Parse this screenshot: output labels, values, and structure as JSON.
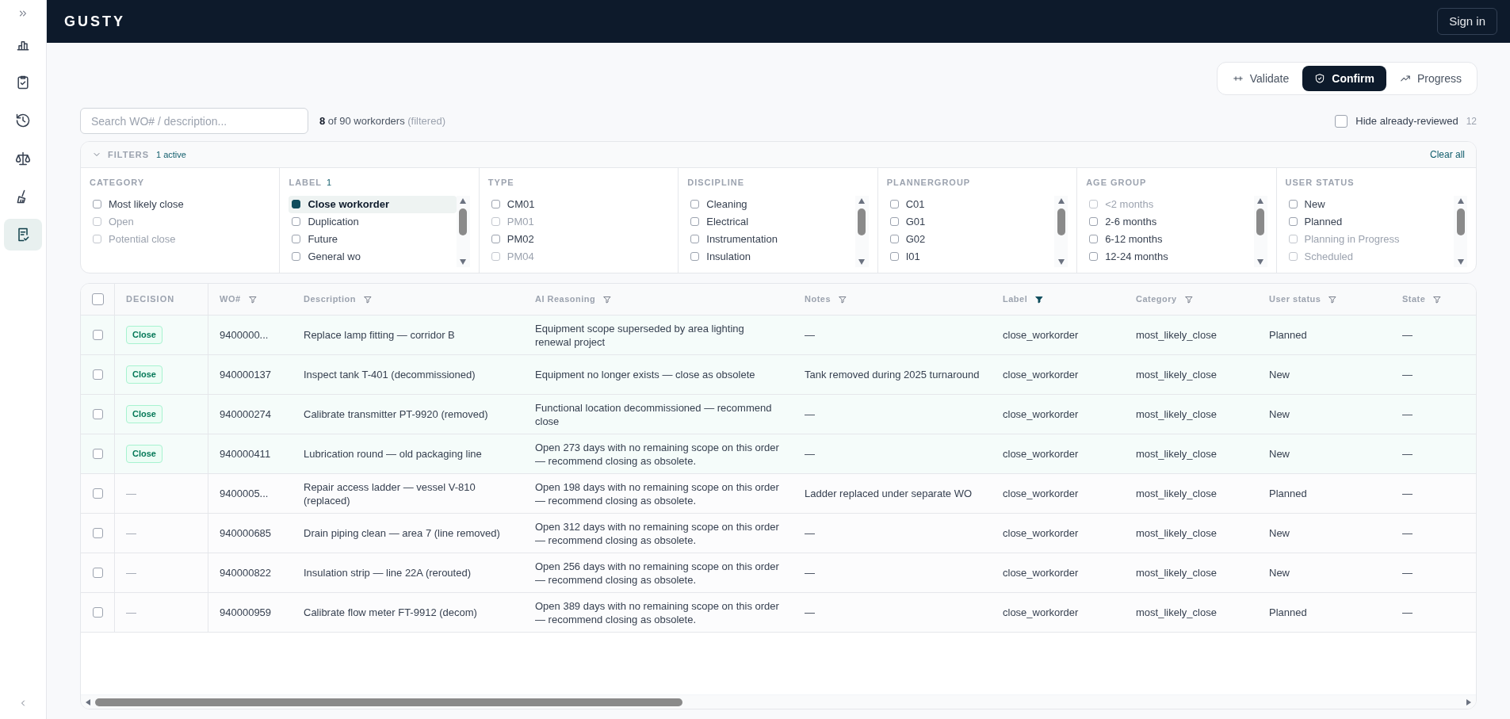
{
  "sidebar": {
    "items": [
      {
        "selected": false
      },
      {
        "selected": false
      },
      {
        "selected": false
      },
      {
        "selected": false
      },
      {
        "selected": false
      },
      {
        "selected": true
      }
    ]
  },
  "header": {
    "logo": "GUSTY",
    "sign_in": "Sign in"
  },
  "tabs": [
    {
      "label": "Validate",
      "selected": false
    },
    {
      "label": "Confirm",
      "selected": true
    },
    {
      "label": "Progress",
      "selected": false
    }
  ],
  "search": {
    "placeholder": "Search WO# / description..."
  },
  "count": {
    "shown": "8",
    "rest": "of 90 workorders",
    "note": "(filtered)"
  },
  "hide_reviewed": {
    "label": "Hide already-reviewed",
    "checked": false,
    "count": "12"
  },
  "filters": {
    "title": "FILTERS",
    "active": "1 active",
    "clear": "Clear all",
    "expanded": true,
    "groups": [
      {
        "title": "CATEGORY",
        "scrollable": false,
        "items": [
          {
            "label": "Most likely close",
            "checked": false,
            "disabled": false
          },
          {
            "label": "Open",
            "checked": false,
            "disabled": true
          },
          {
            "label": "Potential close",
            "checked": false,
            "disabled": true
          }
        ]
      },
      {
        "title": "LABEL",
        "badge": "1",
        "scrollable": true,
        "items": [
          {
            "label": "Close workorder",
            "checked": true,
            "disabled": false
          },
          {
            "label": "Duplication",
            "checked": false,
            "disabled": false
          },
          {
            "label": "Future",
            "checked": false,
            "disabled": false
          },
          {
            "label": "General wo",
            "checked": false,
            "disabled": false
          }
        ]
      },
      {
        "title": "TYPE",
        "scrollable": false,
        "items": [
          {
            "label": "CM01",
            "checked": false,
            "disabled": false
          },
          {
            "label": "PM01",
            "checked": false,
            "disabled": true
          },
          {
            "label": "PM02",
            "checked": false,
            "disabled": false
          },
          {
            "label": "PM04",
            "checked": false,
            "disabled": true
          }
        ]
      },
      {
        "title": "DISCIPLINE",
        "scrollable": true,
        "items": [
          {
            "label": "Cleaning",
            "checked": false,
            "disabled": false
          },
          {
            "label": "Electrical",
            "checked": false,
            "disabled": false
          },
          {
            "label": "Instrumentation",
            "checked": false,
            "disabled": false
          },
          {
            "label": "Insulation",
            "checked": false,
            "disabled": false
          }
        ]
      },
      {
        "title": "PLANNERGROUP",
        "scrollable": true,
        "items": [
          {
            "label": "C01",
            "checked": false,
            "disabled": false
          },
          {
            "label": "G01",
            "checked": false,
            "disabled": false
          },
          {
            "label": "G02",
            "checked": false,
            "disabled": false
          },
          {
            "label": "I01",
            "checked": false,
            "disabled": false
          }
        ]
      },
      {
        "title": "AGE GROUP",
        "scrollable": true,
        "items": [
          {
            "label": "<2 months",
            "checked": false,
            "disabled": true
          },
          {
            "label": "2-6 months",
            "checked": false,
            "disabled": false
          },
          {
            "label": "6-12 months",
            "checked": false,
            "disabled": false
          },
          {
            "label": "12-24 months",
            "checked": false,
            "disabled": false
          }
        ]
      },
      {
        "title": "USER STATUS",
        "scrollable": true,
        "items": [
          {
            "label": "New",
            "checked": false,
            "disabled": false
          },
          {
            "label": "Planned",
            "checked": false,
            "disabled": false
          },
          {
            "label": "Planning in Progress",
            "checked": false,
            "disabled": true
          },
          {
            "label": "Scheduled",
            "checked": false,
            "disabled": true
          }
        ]
      }
    ]
  },
  "table": {
    "all_checked": false,
    "columns": [
      {
        "label": "DECISION"
      },
      {
        "label": "WO#",
        "filter_active": false
      },
      {
        "label": "Description",
        "filter_active": false
      },
      {
        "label": "AI Reasoning",
        "filter_active": false
      },
      {
        "label": "Notes",
        "filter_active": false
      },
      {
        "label": "Label",
        "filter_active": true
      },
      {
        "label": "Category",
        "filter_active": false
      },
      {
        "label": "User status",
        "filter_active": false
      },
      {
        "label": "State",
        "filter_active": false
      }
    ],
    "rows": [
      {
        "checked": false,
        "reviewed": true,
        "cells": [
          "Close",
          "9400000...",
          "Replace lamp fitting — corridor B",
          "Equipment scope superseded by area lighting renewal project",
          "—",
          "close_workorder",
          "most_likely_close",
          "Planned",
          "—"
        ]
      },
      {
        "checked": false,
        "reviewed": true,
        "cells": [
          "Close",
          "940000137",
          "Inspect tank T-401 (decommissioned)",
          "Equipment no longer exists — close as obsolete",
          "Tank removed during 2025 turnaround",
          "close_workorder",
          "most_likely_close",
          "New",
          "—"
        ]
      },
      {
        "checked": false,
        "reviewed": true,
        "cells": [
          "Close",
          "940000274",
          "Calibrate transmitter PT-9920 (removed)",
          "Functional location decommissioned — recommend close",
          "—",
          "close_workorder",
          "most_likely_close",
          "New",
          "—"
        ]
      },
      {
        "checked": false,
        "reviewed": true,
        "cells": [
          "Close",
          "940000411",
          "Lubrication round — old packaging line",
          "Open 273 days with no remaining scope on this order — recommend closing as obsolete.",
          "—",
          "close_workorder",
          "most_likely_close",
          "New",
          "—"
        ]
      },
      {
        "checked": false,
        "reviewed": false,
        "cells": [
          "—",
          "9400005...",
          "Repair access ladder — vessel V-810 (replaced)",
          "Open 198 days with no remaining scope on this order — recommend closing as obsolete.",
          "Ladder replaced under separate WO",
          "close_workorder",
          "most_likely_close",
          "Planned",
          "—"
        ]
      },
      {
        "checked": false,
        "reviewed": false,
        "cells": [
          "—",
          "940000685",
          "Drain piping clean — area 7 (line removed)",
          "Open 312 days with no remaining scope on this order — recommend closing as obsolete.",
          "—",
          "close_workorder",
          "most_likely_close",
          "New",
          "—"
        ]
      },
      {
        "checked": false,
        "reviewed": false,
        "cells": [
          "—",
          "940000822",
          "Insulation strip — line 22A (rerouted)",
          "Open 256 days with no remaining scope on this order — recommend closing as obsolete.",
          "—",
          "close_workorder",
          "most_likely_close",
          "New",
          "—"
        ]
      },
      {
        "checked": false,
        "reviewed": false,
        "cells": [
          "—",
          "940000959",
          "Calibrate flow meter FT-9912 (decom)",
          "Open 389 days with no remaining scope on this order — recommend closing as obsolete.",
          "—",
          "close_workorder",
          "most_likely_close",
          "Planned",
          "—"
        ]
      }
    ]
  }
}
